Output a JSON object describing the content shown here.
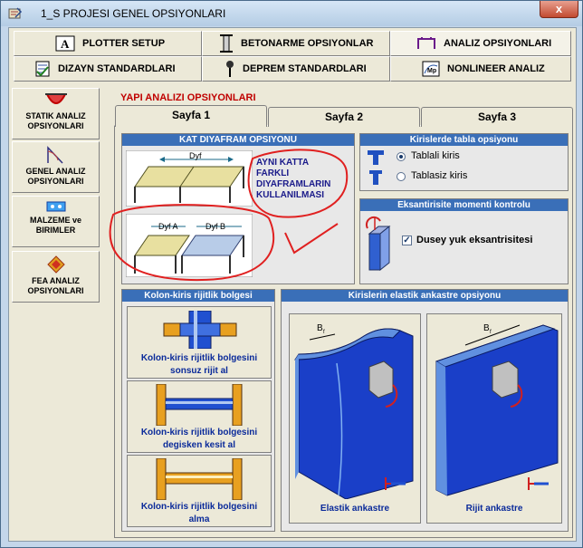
{
  "window": {
    "title": "1_S   PROJESI GENEL OPSIYONLARI",
    "close": "x"
  },
  "top_tabs": [
    {
      "label": "PLOTTER SETUP",
      "icon": "plotter-icon"
    },
    {
      "label": "BETONARME OPSIYONLAR",
      "icon": "column-icon"
    },
    {
      "label": "ANALIZ  OPSIYONLARI",
      "icon": "analysis-icon"
    },
    {
      "label": "DIZAYN STANDARDLARI",
      "icon": "design-icon"
    },
    {
      "label": "DEPREM STANDARDLARI",
      "icon": "earthquake-icon"
    },
    {
      "label": "NONLINEER ANALIZ",
      "icon": "nonlinear-icon"
    }
  ],
  "side_buttons": [
    {
      "line1": "STATIK ANALIZ",
      "line2": "OPSIYONLARI"
    },
    {
      "line1": "GENEL ANALIZ",
      "line2": "OPSIYONLARI"
    },
    {
      "line1": "MALZEME ve",
      "line2": "BIRIMLER"
    },
    {
      "line1": "FEA ANALIZ",
      "line2": "OPSIYONLARI"
    }
  ],
  "section_title": "YAPI ANALIZI  OPSIYONLARI",
  "pages": [
    "Sayfa 1",
    "Sayfa 2",
    "Sayfa 3"
  ],
  "diaphragm": {
    "header": "KAT DIYAFRAM OPSIYONU",
    "dyf": "Dyf",
    "dyf_a": "Dyf A",
    "dyf_b": "Dyf B",
    "note_lines": [
      "AYNI KATTA",
      "FARKLI",
      "DIYAFRAMLARIN",
      "KULLANILMASI"
    ]
  },
  "tabla": {
    "header": "Kirislerde tabla opsiyonu",
    "options": [
      "Tablali kiris",
      "Tablasiz kiris"
    ],
    "selected": 0
  },
  "eksantrisite": {
    "header": "Eksantirisite momenti kontrolu",
    "checkbox": "Dusey  yuk eksantrisitesi",
    "checked": true,
    "check_mark": "✓"
  },
  "rigid_zone": {
    "header": "Kolon-kiris rijitlik bolgesi",
    "options": [
      [
        "Kolon-kiris rijitlik bolgesini",
        "sonsuz rijit al"
      ],
      [
        "Kolon-kiris rijitlik bolgesini",
        "degisken kesit al"
      ],
      [
        "Kolon-kiris rijitlik bolgesini",
        "alma"
      ]
    ]
  },
  "elastic": {
    "header": "Kirislerin  elastik ankastre opsiyonu",
    "bf": "B",
    "bf_sub": "f",
    "options": [
      "Elastik  ankastre",
      "Rijit  ankastre"
    ]
  },
  "colors": {
    "accent": "#3a6fb8",
    "red": "#c00000",
    "annotation": "#e02020",
    "wall": "#1a3fc8"
  }
}
